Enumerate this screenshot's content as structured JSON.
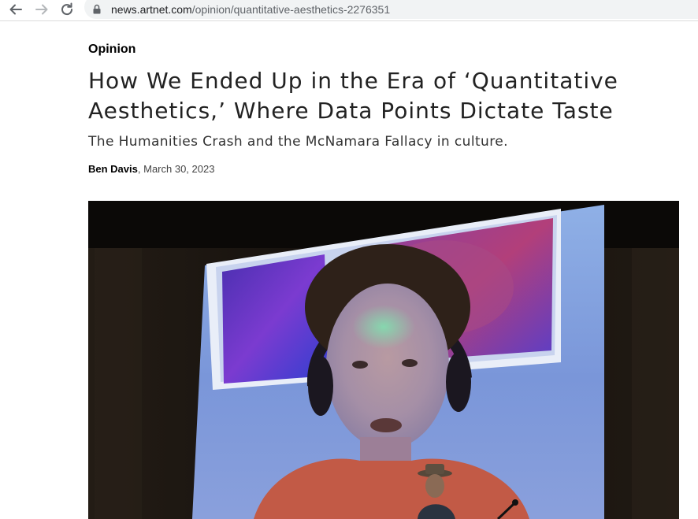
{
  "browser": {
    "url_domain": "news.artnet.com",
    "url_path": "/opinion/quantitative-aesthetics-2276351",
    "icons": [
      "back-arrow-icon",
      "forward-arrow-icon",
      "reload-icon",
      "lock-icon"
    ]
  },
  "article": {
    "section": "Opinion",
    "headline": "How We Ended Up in the Era of ‘Quantitative Aesthetics,’ Where Data Points Dictate Taste",
    "subheadline": "The Humanities Crash and the McNamara Fallacy in culture.",
    "author": "Ben Davis",
    "byline_separator": ", ",
    "date": "March 30, 2023"
  },
  "colors": {
    "omnibox": "#f1f3f4",
    "screen_blue": "#7f9ad8",
    "photo_dark": "#15110d"
  }
}
